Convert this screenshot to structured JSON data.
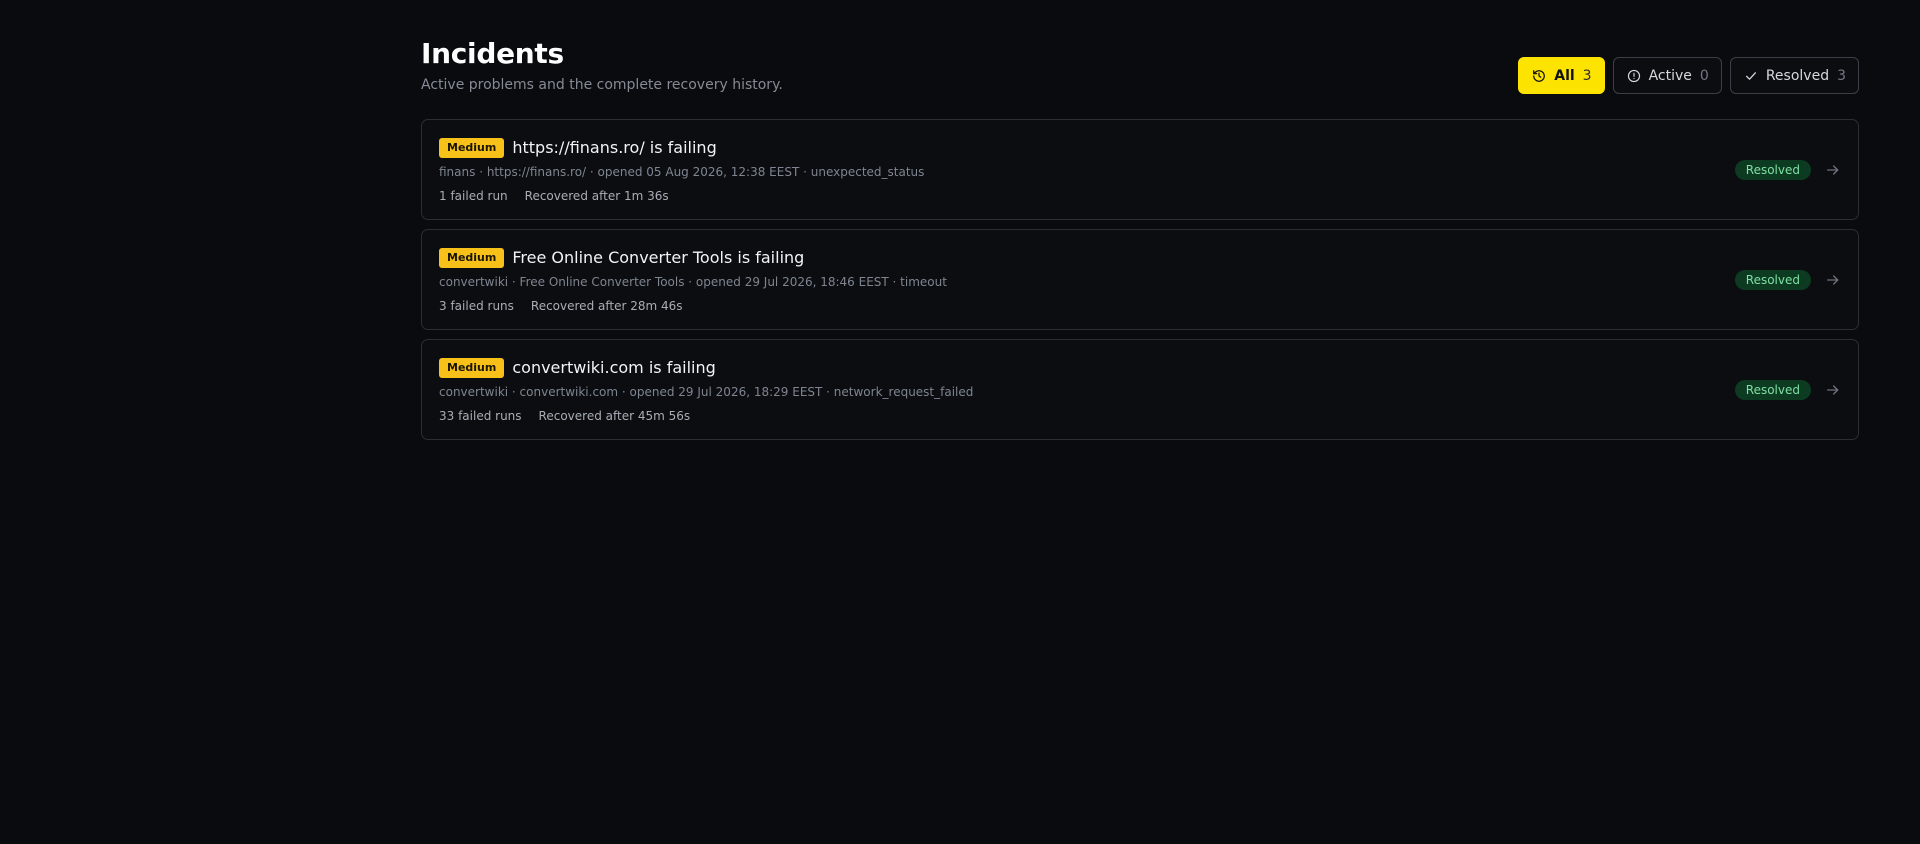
{
  "header": {
    "title": "Incidents",
    "subtitle": "Active problems and the complete recovery history."
  },
  "filters": [
    {
      "label": "All",
      "count": "3",
      "icon": "history-icon",
      "selected": true
    },
    {
      "label": "Active",
      "count": "0",
      "icon": "alert-circle-icon",
      "selected": false
    },
    {
      "label": "Resolved",
      "count": "3",
      "icon": "check-icon",
      "selected": false
    }
  ],
  "colors": {
    "accent": "#fde400",
    "severity_medium": "#f8c11a",
    "status_resolved_bg": "#0d3b22",
    "status_resolved_text": "#7ee0a3"
  },
  "incidents": [
    {
      "severity": "Medium",
      "title": "https://finans.ro/ is failing",
      "meta": "finans · https://finans.ro/ · opened 05 Aug 2026, 12:38 EEST · unexpected_status",
      "failed_runs": "1 failed run",
      "recovery": "Recovered after 1m 36s",
      "status": "Resolved"
    },
    {
      "severity": "Medium",
      "title": "Free Online Converter Tools is failing",
      "meta": "convertwiki · Free Online Converter Tools · opened 29 Jul 2026, 18:46 EEST · timeout",
      "failed_runs": "3 failed runs",
      "recovery": "Recovered after 28m 46s",
      "status": "Resolved"
    },
    {
      "severity": "Medium",
      "title": "convertwiki.com is failing",
      "meta": "convertwiki · convertwiki.com · opened 29 Jul 2026, 18:29 EEST · network_request_failed",
      "failed_runs": "33 failed runs",
      "recovery": "Recovered after 45m 56s",
      "status": "Resolved"
    }
  ]
}
